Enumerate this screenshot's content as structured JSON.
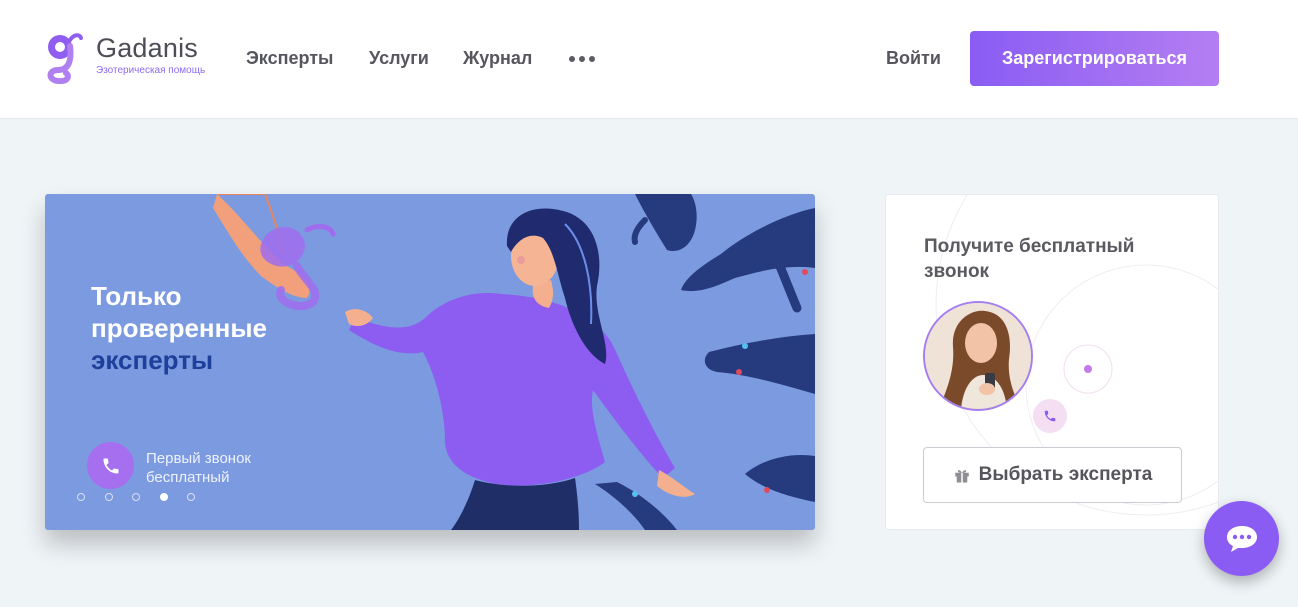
{
  "header": {
    "logo": {
      "name": "Gadanis",
      "tagline": "Эзотерическая помощь"
    },
    "nav": [
      {
        "label": "Эксперты"
      },
      {
        "label": "Услуги"
      },
      {
        "label": "Журнал"
      }
    ],
    "more_icon": "more-dots-icon",
    "login_label": "Войти",
    "register_label": "Зарегистрироваться"
  },
  "banner": {
    "title": "Только проверенные",
    "title_accent": "эксперты",
    "call_text": "Первый звонок бесплатный",
    "call_icon": "phone-icon",
    "slide_count": 5,
    "active_slide": 4
  },
  "call_card": {
    "title": "Получите бесплатный звонок",
    "button_label": "Выбрать эксперта",
    "button_icon": "gift-icon",
    "phone_icon": "phone-icon"
  },
  "chat": {
    "icon": "chat-bubble-icon"
  },
  "colors": {
    "brand": "#8a5cf3",
    "brand_light": "#b47ef2",
    "banner_bg": "#7b9ae0",
    "accent_text": "#1e3f9a",
    "page_bg": "#eff4f7"
  }
}
